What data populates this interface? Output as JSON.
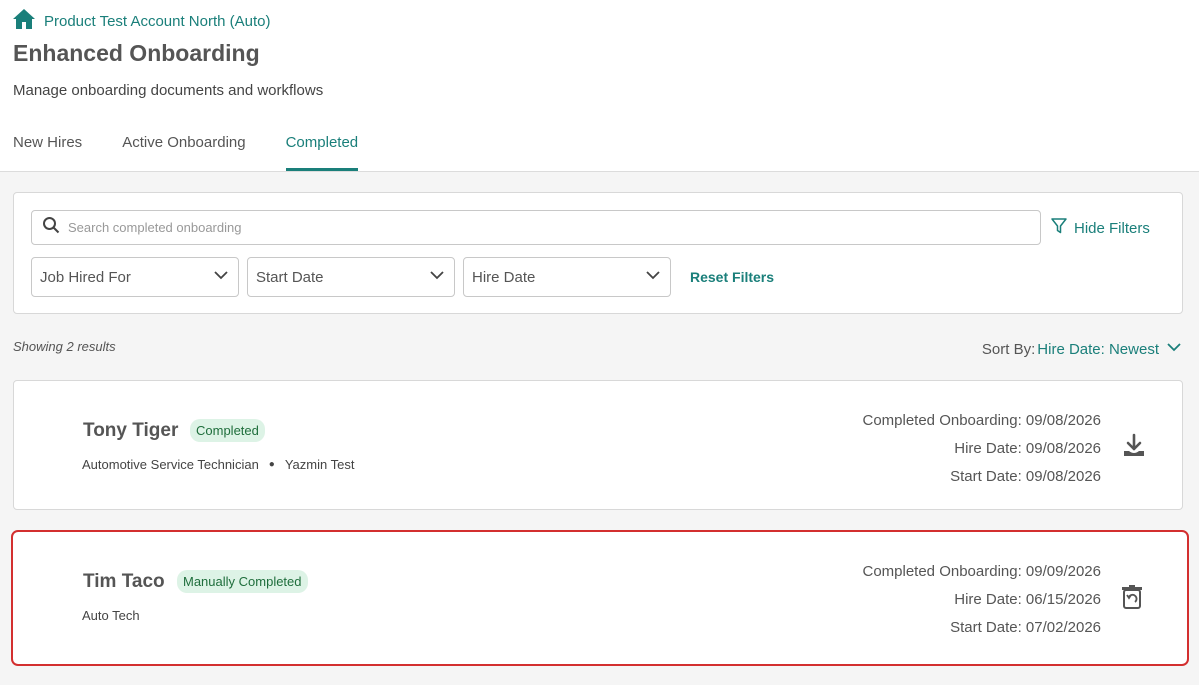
{
  "breadcrumb": {
    "account": "Product Test Account North (Auto)",
    "icon": "home-icon"
  },
  "page": {
    "title": "Enhanced Onboarding",
    "subtitle": "Manage onboarding documents and workflows"
  },
  "tabs": [
    {
      "label": "New Hires",
      "active": false
    },
    {
      "label": "Active Onboarding",
      "active": false
    },
    {
      "label": "Completed",
      "active": true
    }
  ],
  "filters": {
    "search_placeholder": "Search completed onboarding",
    "hide_filters_label": "Hide Filters",
    "dropdowns": [
      {
        "label": "Job Hired For"
      },
      {
        "label": "Start Date"
      },
      {
        "label": "Hire Date"
      }
    ],
    "reset_label": "Reset Filters"
  },
  "results": {
    "count_text": "Showing 2 results",
    "sort_label": "Sort By:",
    "sort_value": "Hire Date: Newest"
  },
  "records": [
    {
      "name": "Tony Tiger",
      "badge": "Completed",
      "job": "Automotive Service Technician",
      "location": "Yazmin Test",
      "completed_onboarding": "Completed Onboarding: 09/08/2026",
      "hire_date": "Hire Date: 09/08/2026",
      "start_date": "Start Date: 09/08/2026",
      "action_icon": "download-icon"
    },
    {
      "name": "Tim Taco",
      "badge": "Manually Completed",
      "job": "Auto Tech",
      "completed_onboarding": "Completed Onboarding: 09/09/2026",
      "hire_date": "Hire Date: 06/15/2026",
      "start_date": "Start Date: 07/02/2026",
      "action_icon": "restore-trash-icon"
    }
  ],
  "colors": {
    "accent": "#1a7f7a",
    "badge_bg": "#ddf3e6",
    "badge_text": "#1f6e3c",
    "highlight_border": "#d32f2f"
  }
}
